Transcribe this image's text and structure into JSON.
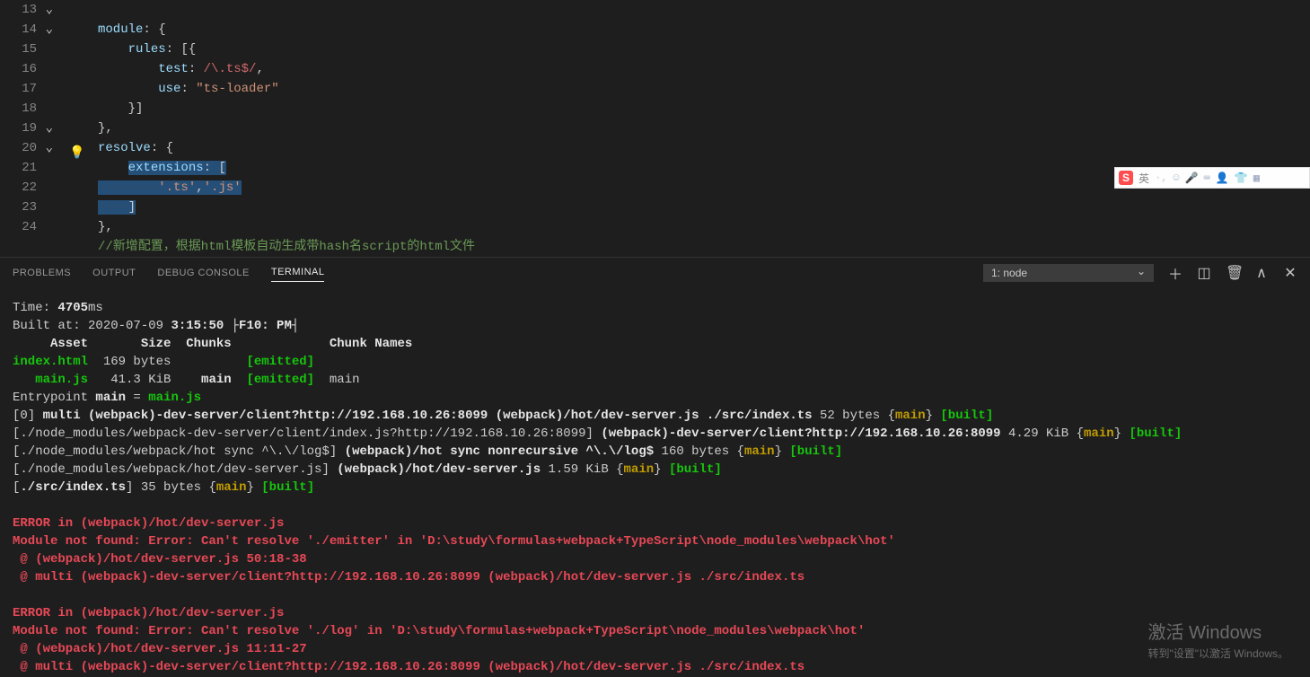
{
  "editor": {
    "lines": [
      {
        "num": "13",
        "chev": true
      },
      {
        "num": "14",
        "chev": true
      },
      {
        "num": "15",
        "chev": false
      },
      {
        "num": "16",
        "chev": false
      },
      {
        "num": "17",
        "chev": false
      },
      {
        "num": "18",
        "chev": false
      },
      {
        "num": "19",
        "chev": true
      },
      {
        "num": "20",
        "chev": true
      },
      {
        "num": "21",
        "chev": false
      },
      {
        "num": "22",
        "chev": false
      },
      {
        "num": "23",
        "chev": false
      },
      {
        "num": "24",
        "chev": false
      }
    ],
    "tokens": {
      "module": "module",
      "rules": "rules",
      "test": "test",
      "use": "use",
      "resolve": "resolve",
      "extensions": "extensions",
      "regex": "/\\.ts$/",
      "tsloader": "\"ts-loader\"",
      "ts_str": "'.ts'",
      "js_str": "'.js'",
      "comment": "//新增配置，根据html模板自动生成带hash名script的html文件",
      "colon": ":",
      "comma": ",",
      "ob": "{",
      "cb": "}",
      "obr": "[",
      "cbr": "]",
      "obcb": "[{",
      "cbcbr": "}]",
      "cbcomma": "},"
    }
  },
  "panel": {
    "tabs": {
      "problems": "PROBLEMS",
      "output": "OUTPUT",
      "debug": "DEBUG CONSOLE",
      "terminal": "TERMINAL"
    },
    "terminal_select": "1: node"
  },
  "terminal": {
    "time_label": "Time: ",
    "time_value": "4705",
    "time_suffix": "ms",
    "built_at_label": "Built at: ",
    "built_at_date": "2020-07-09 ",
    "built_at_time": "3:15:50 ├F10: PM┤",
    "header": "     Asset       Size  Chunks             Chunk Names",
    "row1_asset": "index.html",
    "row1_rest": "  169 bytes          ",
    "row1_emitted": "[emitted]",
    "row2_asset": "   main.js",
    "row2_rest": "   41.3 KiB    ",
    "row2_chunk": "main",
    "row2_emitted": "[emitted]",
    "row2_name": "  main",
    "entry_label": "Entrypoint ",
    "entry_main": "main",
    "entry_eq": " = ",
    "entry_file": "main.js",
    "l0_a": "[0] ",
    "l0_b": "multi (webpack)-dev-server/client?http://192.168.10.26:8099 (webpack)/hot/dev-server.js ./src/index.ts",
    "l0_c": " 52 bytes {",
    "l0_main": "main",
    "l0_d": "} ",
    "l0_built": "[built]",
    "l1_a": "[./node_modules/webpack-dev-server/client/index.js?http://192.168.10.26:8099] ",
    "l1_b": "(webpack)-dev-server/client?http://192.168.10.26:8099",
    "l1_c": " 4.29 KiB {",
    "l2_a": "[./node_modules/webpack/hot sync ^\\.\\/log$] ",
    "l2_b": "(webpack)/hot sync nonrecursive ^\\.\\/log$",
    "l2_c": " 160 bytes {",
    "l3_a": "[./node_modules/webpack/hot/dev-server.js] ",
    "l3_b": "(webpack)/hot/dev-server.js",
    "l3_c": " 1.59 KiB {",
    "l4_a": "[",
    "l4_b": "./src/index.ts",
    "l4_c": "] 35 bytes {",
    "err1_l1": "ERROR in (webpack)/hot/dev-server.js",
    "err1_l2": "Module not found: Error: Can't resolve './emitter' in 'D:\\study\\formulas+webpack+TypeScript\\node_modules\\webpack\\hot'",
    "err1_l3": " @ (webpack)/hot/dev-server.js 50:18-38",
    "err1_l4": " @ multi (webpack)-dev-server/client?http://192.168.10.26:8099 (webpack)/hot/dev-server.js ./src/index.ts",
    "err2_l1": "ERROR in (webpack)/hot/dev-server.js",
    "err2_l2": "Module not found: Error: Can't resolve './log' in 'D:\\study\\formulas+webpack+TypeScript\\node_modules\\webpack\\hot'",
    "err2_l3": " @ (webpack)/hot/dev-server.js 11:11-27",
    "err2_l4": " @ multi (webpack)-dev-server/client?http://192.168.10.26:8099 (webpack)/hot/dev-server.js ./src/index.ts"
  },
  "ime": {
    "s": "S",
    "lang": "英",
    "sep1": "·,",
    "face": "☺",
    "mic": "🎤",
    "kbd": "⌨",
    "person": "👤",
    "shirt": "👕",
    "grid": "▦"
  },
  "watermark": {
    "t1": "激活 Windows",
    "t2": "转到\"设置\"以激活 Windows。"
  }
}
